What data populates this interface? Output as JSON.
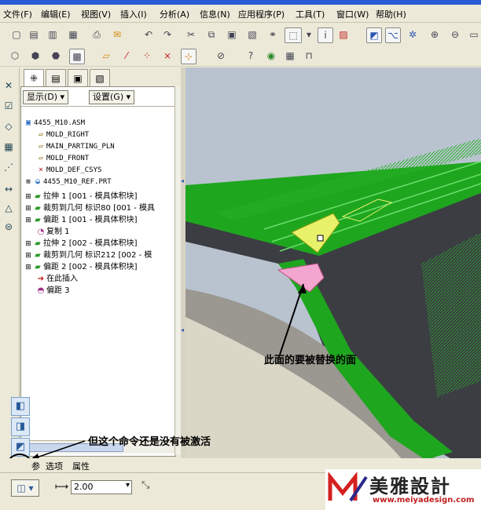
{
  "menu": [
    "文件(F)",
    "编辑(E)",
    "视图(V)",
    "插入(I)",
    "分析(A)",
    "信息(N)",
    "应用程序(P)",
    "工具(T)",
    "窗口(W)",
    "帮助(H)"
  ],
  "model_tree": {
    "show_btn": "显示(D) ▾",
    "settings_btn": "设置(G) ▾",
    "rows": [
      "4455_M10.ASM",
      "MOLD_RIGHT",
      "MAIN_PARTING_PLN",
      "MOLD_FRONT",
      "MOLD_DEF_CSYS",
      "4455_M10_REF.PRT",
      "拉伸 1 [001 - 模具体积块]",
      "裁剪到几何 标识80 [001 - 模具",
      "偏距 1 [001 - 模具体积块]",
      "复制 1",
      "拉伸 2 [002 - 模具体积块]",
      "裁剪到几何 标识212 [002 - 模",
      "偏距 2 [002 - 模具体积块]",
      "在此插入",
      "偏距 3"
    ]
  },
  "annotations": {
    "face_note": "此面的要被替换的面",
    "command_note": "但这个命令还是没有被激活"
  },
  "bottom_tabs": {
    "ref": "参",
    "options": "选项",
    "properties": "属性"
  },
  "dashboard": {
    "offset_value": "2.00",
    "offset_placeholder": ""
  },
  "logo": {
    "cn": "美雅設計",
    "url": "www.meiyadesign.com"
  },
  "colors": {
    "accent_green": "#1fa61f",
    "face_pink": "#f3a6cf",
    "highlight_yellow": "#e8f16a"
  }
}
